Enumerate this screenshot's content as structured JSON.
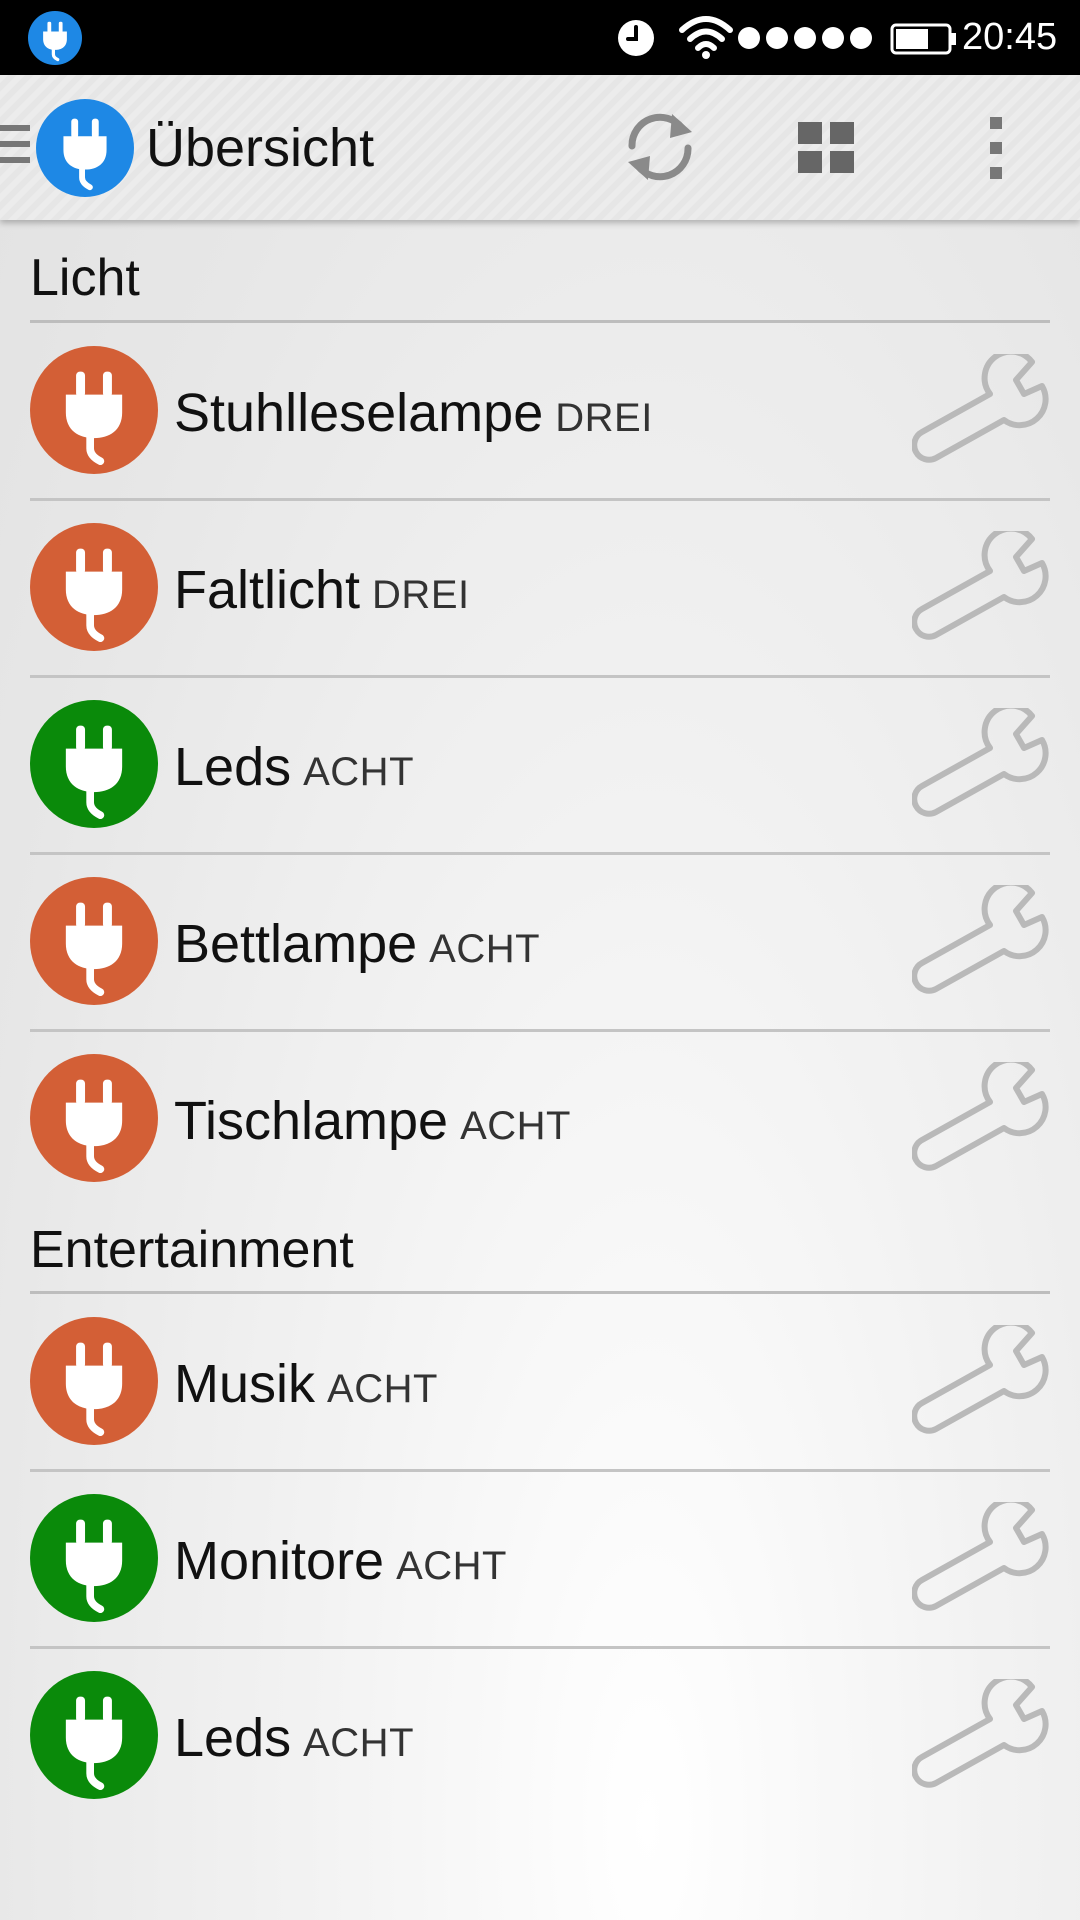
{
  "status_bar": {
    "time": "20:45",
    "app_icon": "plug-icon",
    "icons": [
      "alarm-clock-icon",
      "wifi-icon",
      "signal-dots",
      "battery-icon"
    ]
  },
  "action_bar": {
    "title": "Übersicht",
    "actions": [
      "refresh-icon",
      "grid-view-icon",
      "overflow-menu-icon"
    ]
  },
  "colors": {
    "on": "#0a8a0a",
    "off": "#d35f36",
    "accent": "#1e88e5"
  },
  "sections": [
    {
      "title": "Licht",
      "devices": [
        {
          "name": "Stuhlleselampe",
          "room": "DREI",
          "state": "off"
        },
        {
          "name": "Faltlicht",
          "room": "DREI",
          "state": "off"
        },
        {
          "name": "Leds",
          "room": "ACHT",
          "state": "on"
        },
        {
          "name": "Bettlampe",
          "room": "ACHT",
          "state": "off"
        },
        {
          "name": "Tischlampe",
          "room": "ACHT",
          "state": "off"
        }
      ]
    },
    {
      "title": "Entertainment",
      "devices": [
        {
          "name": "Musik",
          "room": "ACHT",
          "state": "off"
        },
        {
          "name": "Monitore",
          "room": "ACHT",
          "state": "on"
        },
        {
          "name": "Leds",
          "room": "ACHT",
          "state": "on"
        }
      ]
    }
  ]
}
